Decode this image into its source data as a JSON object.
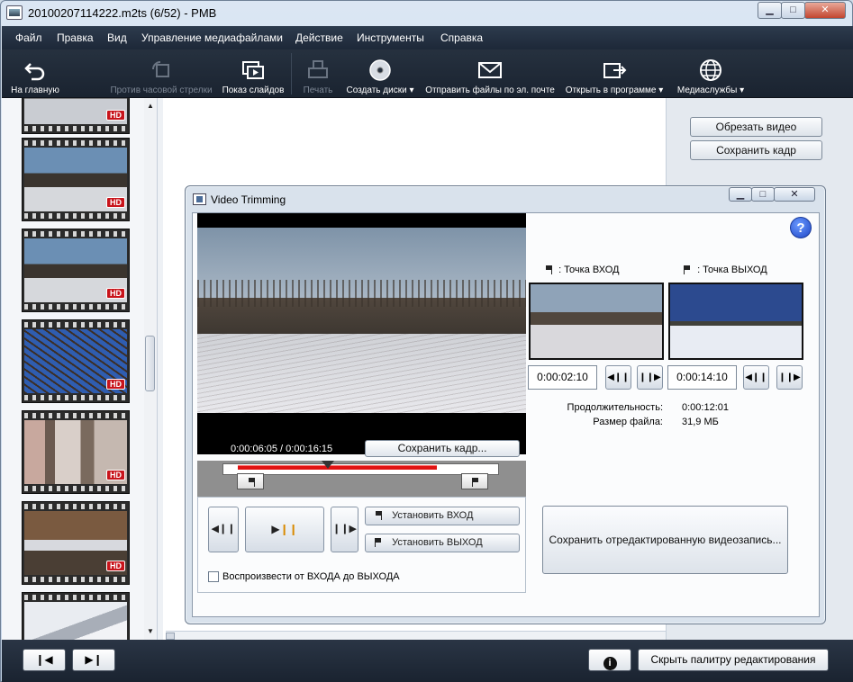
{
  "window": {
    "title": "20100207114222.m2ts (6/52)  -  PMB"
  },
  "menu": [
    "Файл",
    "Правка",
    "Вид",
    "Управление медиафайлами",
    "Действие",
    "Инструменты",
    "Справка"
  ],
  "toolbar": {
    "home": "На главную",
    "rotate": "Против часовой стрелки",
    "slideshow": "Показ слайдов",
    "print": "Печать",
    "create_discs": "Создать диски",
    "email": "Отправить файлы по эл. почте",
    "open_in": "Открыть в программе",
    "media_services": "Медиаслужбы"
  },
  "thumb_badge": "HD",
  "right_panel": {
    "trim_video": "Обрезать видео",
    "save_frame": "Сохранить кадр"
  },
  "dialog": {
    "title": "Video Trimming",
    "timecode": "0:00:06:05 / 0:00:16:15",
    "save_frame_btn": "Сохранить кадр...",
    "set_in": "Установить ВХОД",
    "set_out": "Установить ВЫХОД",
    "play_in_out": "Воспроизвести от ВХОДА до ВЫХОДА",
    "in_point_label": ": Точка ВХОД",
    "out_point_label": ": Точка ВЫХОД",
    "in_time": "0:00:02:10",
    "out_time": "0:00:14:10",
    "duration_label": "Продолжительность:",
    "duration_value": "0:00:12:01",
    "filesize_label": "Размер файла:",
    "filesize_value": "31,9 МБ",
    "save_edited": "Сохранить отредактированную видеозапись...",
    "help": "?"
  },
  "bottom": {
    "hide_palette": "Скрыть палитру редактирования"
  }
}
